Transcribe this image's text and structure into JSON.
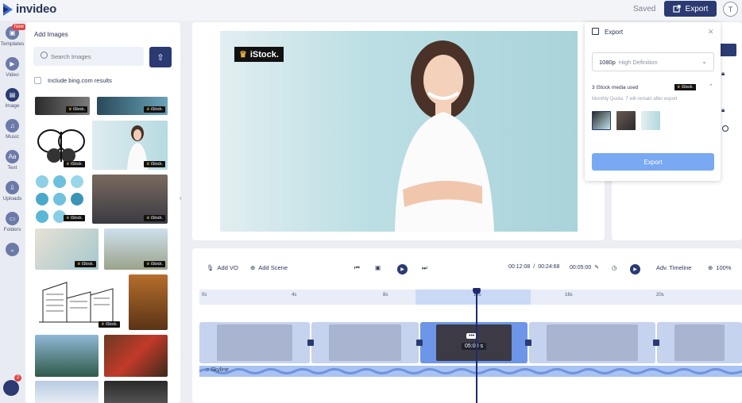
{
  "app": {
    "name": "invideo",
    "save_status": "Saved",
    "export_label": "Export",
    "user_initial": "T"
  },
  "rail": {
    "items": [
      {
        "label": "Templates",
        "badge": "New"
      },
      {
        "label": "Video"
      },
      {
        "label": "Image"
      },
      {
        "label": "Music"
      },
      {
        "label": "Text",
        "icon_text": "Aa"
      },
      {
        "label": "Uploads"
      },
      {
        "label": "Folders"
      }
    ],
    "chat_badge": "2"
  },
  "images": {
    "title": "Add Images",
    "search_placeholder": "Search Images",
    "bing_label": "Include bing.com results",
    "tag": "iStock."
  },
  "preview": {
    "watermark": "iStock."
  },
  "export_popover": {
    "title": "Export",
    "resolution": "1080p",
    "quality": "High Definition",
    "media_used": "3 iStock media used",
    "media_tag": "iStock.",
    "quota": "Monthly Quota: 7 will remain after export",
    "export_button": "Export"
  },
  "timeline": {
    "add_vo": "Add VO",
    "add_scene": "Add Scene",
    "current_time": "00:12:08",
    "total_time": "00:24:68",
    "scene_duration": "00:05:00",
    "adv_timeline": "Adv. Timeline",
    "zoom": "100%",
    "ticks": [
      "0s",
      "4s",
      "8s",
      "12s",
      "16s",
      "20s"
    ],
    "active_scene_time": "05:00 s",
    "active_scene_menu": "•••",
    "audio_track": "Skyline"
  },
  "colors": {
    "brand": "#2b3a72",
    "accent_light": "#7aa9f3",
    "badge_red": "#e04545"
  }
}
